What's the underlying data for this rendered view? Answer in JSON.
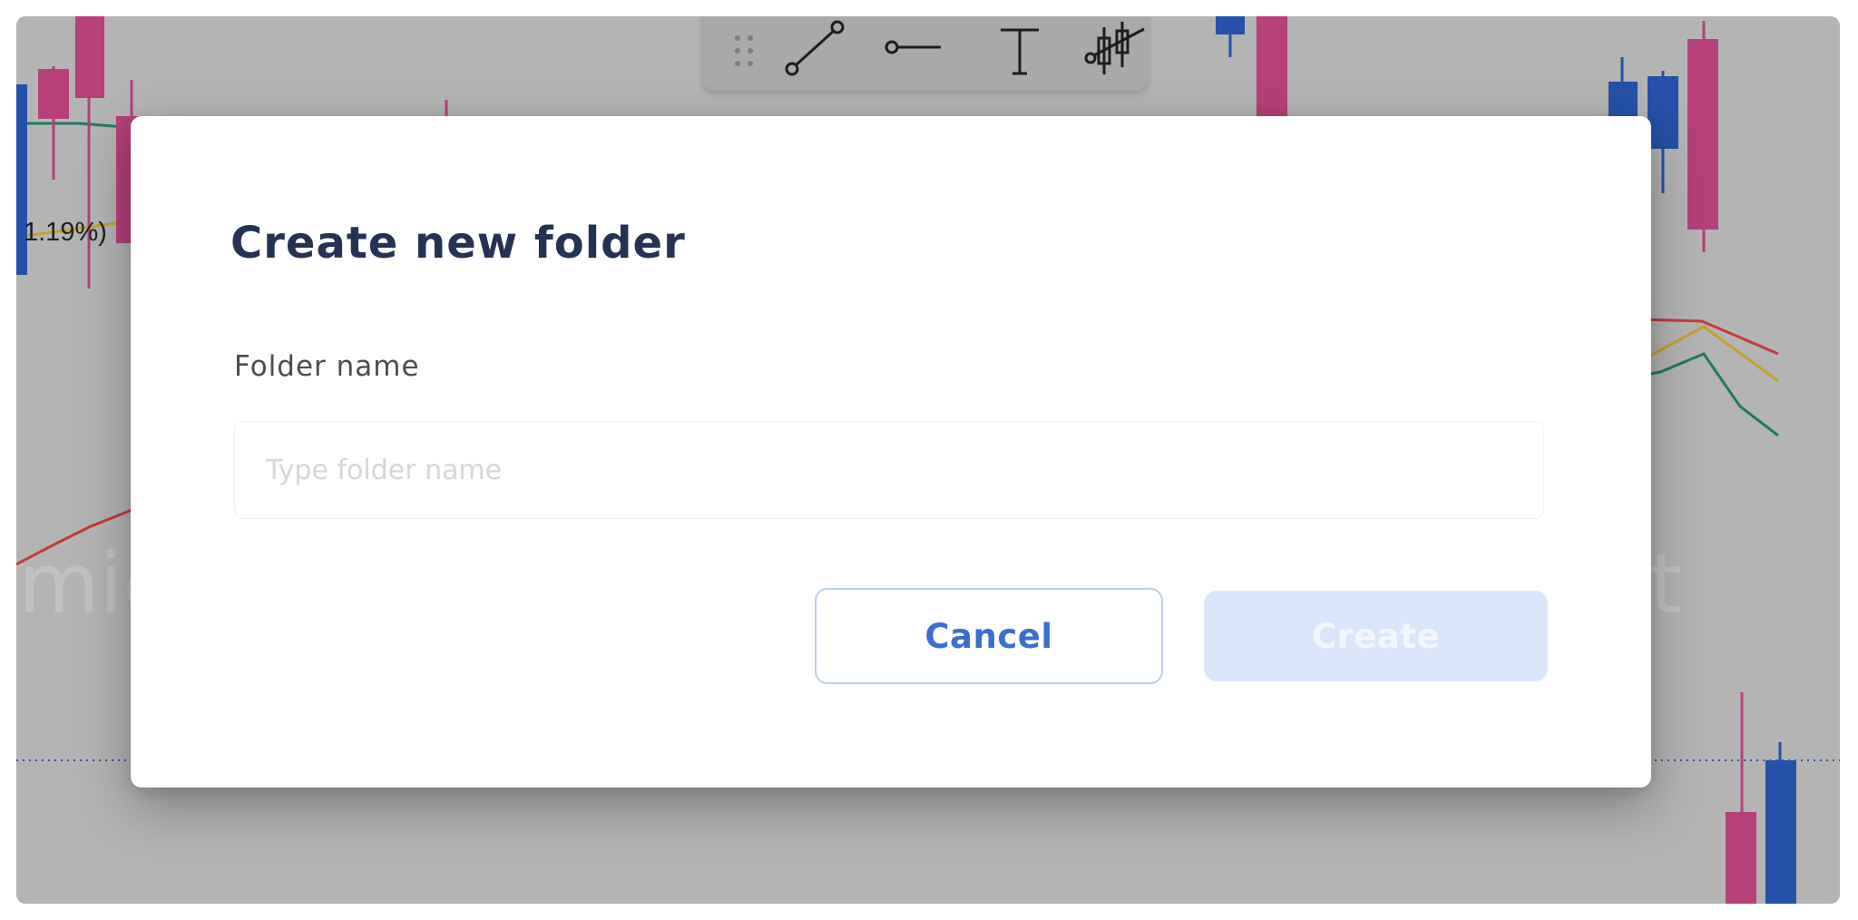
{
  "background": {
    "percent_label": "1.19%)",
    "ghost_text_left": "mic",
    "ghost_text_right": "t"
  },
  "toolbar": {
    "tools": [
      {
        "name": "drag-handle-icon"
      },
      {
        "name": "trend-line-icon"
      },
      {
        "name": "horizontal-ray-icon"
      },
      {
        "name": "text-tool-icon"
      },
      {
        "name": "candlestick-pattern-icon"
      }
    ]
  },
  "dialog": {
    "title": "Create new folder",
    "field_label": "Folder name",
    "input_value": "",
    "input_placeholder": "Type folder name",
    "cancel_label": "Cancel",
    "create_label": "Create"
  },
  "colors": {
    "accent": "#3a6fd0",
    "title": "#253253",
    "create_disabled_bg": "#dce6fb",
    "candle_up": "#2452a8",
    "candle_down": "#b5407a"
  }
}
